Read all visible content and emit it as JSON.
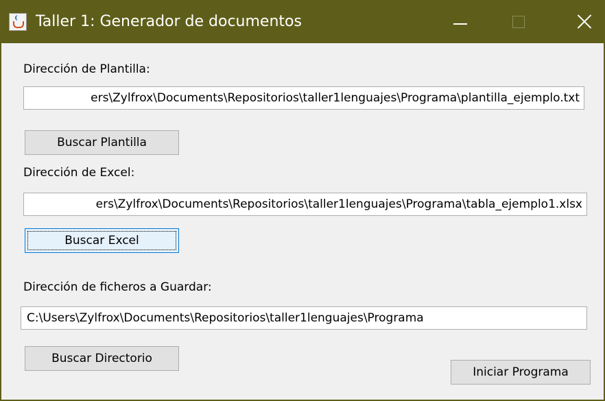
{
  "window": {
    "title": "Taller 1: Generador de documentos",
    "icon": "java-cup-icon",
    "controls": {
      "minimize": "minimize-icon",
      "maximize": "maximize-icon",
      "close": "close-icon"
    }
  },
  "plantilla": {
    "label": "Dirección de Plantilla:",
    "value": "ers\\Zylfrox\\Documents\\Repositorios\\taller1lenguajes\\Programa\\plantilla_ejemplo.txt",
    "button": "Buscar Plantilla"
  },
  "excel": {
    "label": "Dirección de Excel:",
    "value": "ers\\Zylfrox\\Documents\\Repositorios\\taller1lenguajes\\Programa\\tabla_ejemplo1.xlsx",
    "button": "Buscar Excel"
  },
  "guardar": {
    "label": "Dirección de ficheros a Guardar:",
    "value": "C:\\Users\\Zylfrox\\Documents\\Repositorios\\taller1lenguajes\\Programa",
    "button": "Buscar Directorio"
  },
  "actions": {
    "start": "Iniciar Programa"
  },
  "colors": {
    "titlebar": "#5e5e1a",
    "window_bg": "#f0f0f0",
    "focus_border": "#0078d7"
  }
}
